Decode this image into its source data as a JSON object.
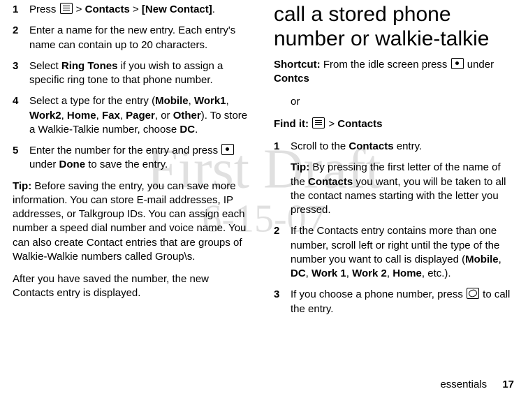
{
  "watermark": {
    "line1": "First Draft",
    "line2": "6-15-07"
  },
  "left": {
    "steps": [
      {
        "num": "1",
        "parts": [
          "Press ",
          "[ICON:menu]",
          " > ",
          "{cond}Contacts",
          " > ",
          "{cond}[New Contact]",
          "."
        ]
      },
      {
        "num": "2",
        "parts": [
          "Enter a name for the new entry. Each entry's name can contain up to 20 characters."
        ]
      },
      {
        "num": "3",
        "parts": [
          "Select ",
          "{cond}Ring Tones",
          " if you wish to assign a specific ring tone to that phone number."
        ]
      },
      {
        "num": "4",
        "parts": [
          "Select a type for the entry (",
          "{cond}Mobile",
          ", ",
          "{cond}Work1",
          ", ",
          "{cond}Work2",
          ", ",
          "{cond}Home",
          ", ",
          "{cond}Fax",
          ", ",
          "{cond}Pager",
          ", or ",
          "{cond}Other",
          "). To store a Walkie-Talkie number, choose ",
          "{cond}DC",
          "."
        ]
      },
      {
        "num": "5",
        "parts": [
          "Enter the number for the entry and press ",
          "[ICON:dot]",
          " under ",
          "{cond}Done",
          " to save the entry."
        ]
      }
    ],
    "tip_label": "Tip:",
    "tip_text": " Before saving the entry, you can save more information. You can store E-mail addresses, IP addresses, or Talkgroup IDs. You can assign each number a speed dial number and voice name. You can also create Contact entries that are groups of Walkie-Walkie numbers called Group\\s.",
    "after": "After you have saved the number, the new Contacts entry is displayed."
  },
  "right": {
    "title": "call a stored phone number or walkie-talkie",
    "shortcut_label": "Shortcut:",
    "shortcut_parts": [
      " From the idle screen press ",
      "[ICON:dot]",
      " under ",
      "{cond}Contcs"
    ],
    "or": "or",
    "findit_label": "Find it:",
    "findit_parts": [
      " ",
      "[ICON:menu]",
      " > ",
      "{cond}Contacts"
    ],
    "steps": [
      {
        "num": "1",
        "parts": [
          "Scroll to the ",
          "{cond}Contacts",
          " entry."
        ]
      },
      {
        "num": "2",
        "parts": [
          "If the Contacts entry contains more than one number, scroll left or right until the type of the number you want to call is displayed (",
          "{cond}Mobile",
          ", ",
          "{cond}DC",
          ", ",
          "{cond}Work 1",
          ", ",
          "{cond}Work 2",
          ", ",
          "{cond}Home",
          ", etc.)."
        ]
      },
      {
        "num": "3",
        "parts": [
          "If you choose a phone number, press ",
          "[ICON:send]",
          " to call the entry."
        ]
      }
    ],
    "tip_label": "Tip:",
    "tip_parts": [
      " By pressing the first letter of the name of the ",
      "{cond}Contacts",
      " you want, you will be taken to all the contact names starting with the letter you pressed."
    ]
  },
  "footer": {
    "section": "essentials",
    "page": "17"
  }
}
